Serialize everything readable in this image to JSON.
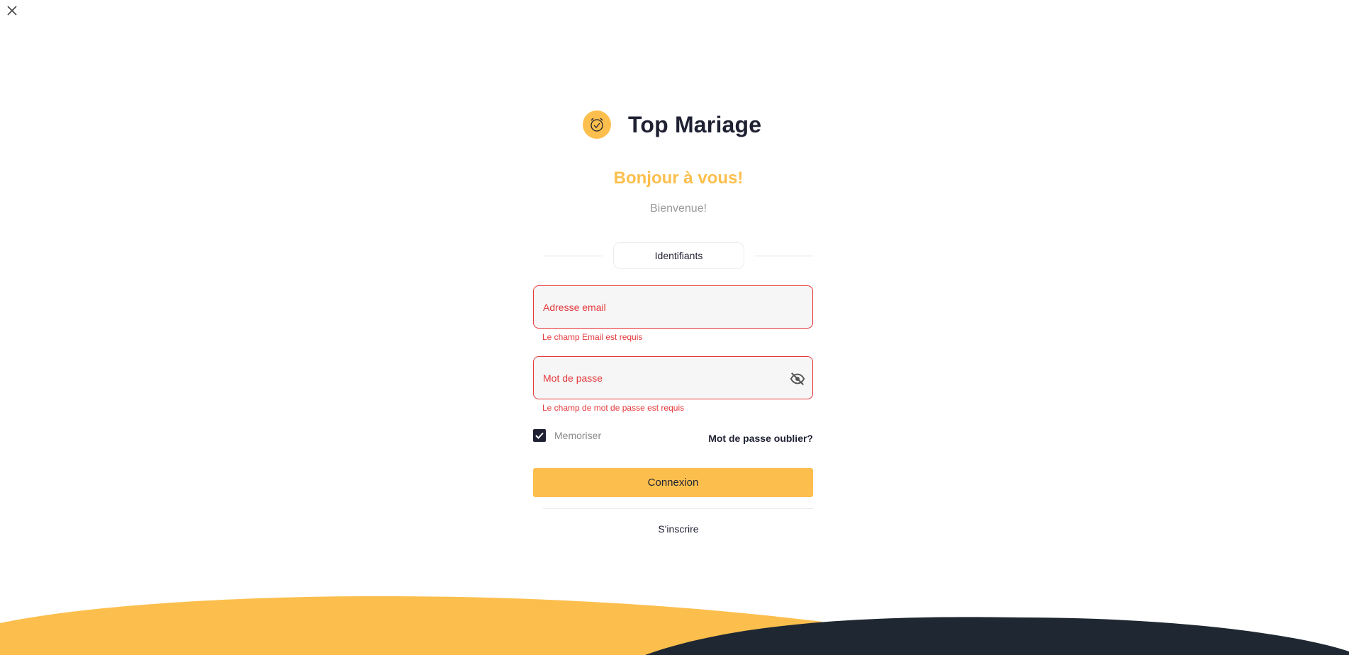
{
  "brand": {
    "name": "Top Mariage",
    "logo_icon": "alarm-clock-icon",
    "logo_color": "#fcbf4d"
  },
  "header": {
    "greeting": "Bonjour à vous!",
    "welcome": "Bienvenue!"
  },
  "section": {
    "credentials_label": "Identifiants"
  },
  "form": {
    "email_label": "Adresse email",
    "email_error": "Le champ Email est requis",
    "password_label": "Mot de passe",
    "password_error": "Le champ de mot de passe est requis",
    "remember_label": "Memoriser",
    "remember_checked": true,
    "forgot_label": "Mot de passe oublier?",
    "submit_label": "Connexion",
    "signup_label": "S'inscrire"
  },
  "icons": {
    "close": "close-icon",
    "password_visibility": "eye-off-icon",
    "checkbox": "checkmark-icon"
  },
  "colors": {
    "accent": "#fcbf4d",
    "error": "#e5383b",
    "dark": "#1f2133",
    "muted": "#9a9a9a"
  }
}
